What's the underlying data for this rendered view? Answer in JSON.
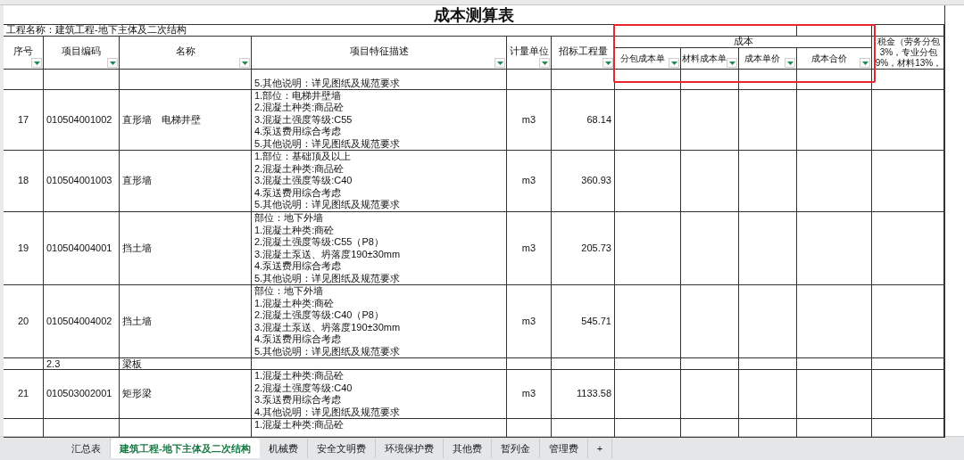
{
  "title": "成本测算表",
  "project_name": "工程名称：建筑工程-地下主体及二次结构",
  "cost_group": {
    "label": "成本",
    "highlighted": true
  },
  "columns": [
    {
      "label": "序号",
      "filter": true
    },
    {
      "label": "项目编码",
      "filter": true
    },
    {
      "label": "名称",
      "filter": true
    },
    {
      "label": "项目特征描述",
      "filter": true
    },
    {
      "label": "计量单位",
      "filter": true
    },
    {
      "label": "招标工程量",
      "filter": true
    },
    {
      "label": "分包成本单",
      "filter": true
    },
    {
      "label": "材料成本单",
      "filter": true
    },
    {
      "label": "成本单价",
      "filter": true
    },
    {
      "label": "成本合价",
      "filter": true
    },
    {
      "label": "税金（劳务分包3%，专业分包9%，材料13%，",
      "filter": false
    }
  ],
  "rows": [
    {
      "kind": "item",
      "no": "",
      "code": "",
      "name": "",
      "description": [
        "5.其他说明：详见图纸及规范要求"
      ],
      "unit": "",
      "quantity": ""
    },
    {
      "kind": "item",
      "no": "17",
      "code": "010504001002",
      "name": "直形墙　电梯井壁",
      "description": [
        "1.部位：电梯井壁墙",
        "2.混凝土种类:商品砼",
        "3.混凝土强度等级:C55",
        "4.泵送费用综合考虑",
        "5.其他说明：详见图纸及规范要求"
      ],
      "unit": "m3",
      "quantity": "68.14"
    },
    {
      "kind": "item",
      "no": "18",
      "code": "010504001003",
      "name": "直形墙",
      "description": [
        "1.部位：基础顶及以上",
        "2.混凝土种类:商品砼",
        "3.混凝土强度等级:C40",
        "4.泵送费用综合考虑",
        "5.其他说明：详见图纸及规范要求"
      ],
      "unit": "m3",
      "quantity": "360.93"
    },
    {
      "kind": "item",
      "no": "19",
      "code": "010504004001",
      "name": "挡土墙",
      "description": [
        "部位：地下外墙",
        "1.混凝土种类:商砼",
        "2.混凝土强度等级:C55（P8）",
        "3.混凝土泵送、坍落度190±30mm",
        "4.泵送费用综合考虑",
        "5.其他说明：详见图纸及规范要求"
      ],
      "unit": "m3",
      "quantity": "205.73"
    },
    {
      "kind": "item",
      "no": "20",
      "code": "010504004002",
      "name": "挡土墙",
      "description": [
        "部位：地下外墙",
        "1.混凝土种类:商砼",
        "2.混凝土强度等级:C40（P8）",
        "3.混凝土泵送、坍落度190±30mm",
        "4.泵送费用综合考虑",
        "5.其他说明：详见图纸及规范要求"
      ],
      "unit": "m3",
      "quantity": "545.71"
    },
    {
      "kind": "section",
      "no": "",
      "code": "2.3",
      "name": "梁板",
      "description": [],
      "unit": "",
      "quantity": ""
    },
    {
      "kind": "item",
      "no": "21",
      "code": "010503002001",
      "name": "矩形梁",
      "description": [
        "1.混凝土种类:商品砼",
        "2.混凝土强度等级:C40",
        "3.泵送费用综合考虑",
        "4.其他说明：详见图纸及规范要求"
      ],
      "unit": "m3",
      "quantity": "1133.58"
    },
    {
      "kind": "item",
      "no": "",
      "code": "",
      "name": "",
      "description": [
        "1.混凝土种类:商品砼"
      ],
      "unit": "",
      "quantity": ""
    }
  ],
  "sheet_tabs": [
    {
      "label": "汇总表",
      "selected": false
    },
    {
      "label": "建筑工程-地下主体及二次结构",
      "selected": true
    },
    {
      "label": "机械费",
      "selected": false
    },
    {
      "label": "安全文明费",
      "selected": false
    },
    {
      "label": "环境保护费",
      "selected": false
    },
    {
      "label": "其他费",
      "selected": false
    },
    {
      "label": "暂列金",
      "selected": false
    },
    {
      "label": "管理费",
      "selected": false
    },
    {
      "label": "+",
      "selected": false
    }
  ]
}
